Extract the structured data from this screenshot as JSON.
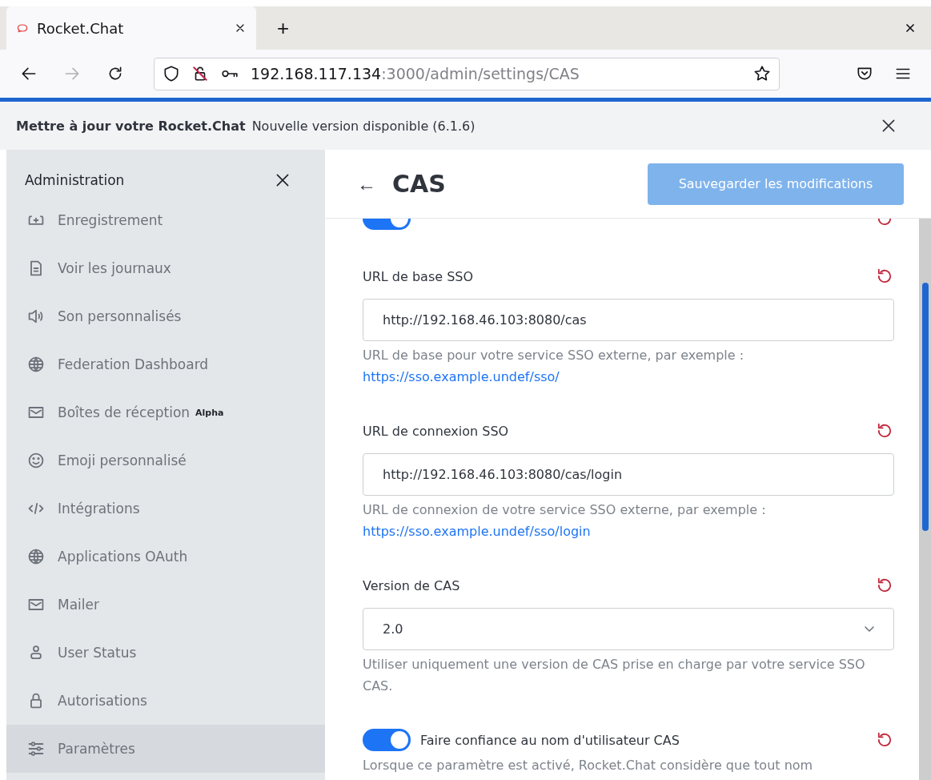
{
  "browser": {
    "tab": {
      "title": "Rocket.Chat"
    },
    "new_tab": "+",
    "url": {
      "host": "192.168.117.134",
      "path": ":3000/admin/settings/CAS"
    }
  },
  "banner": {
    "title": "Mettre à jour votre Rocket.Chat",
    "message": "Nouvelle version disponible (6.1.6)"
  },
  "sidebar": {
    "title": "Administration",
    "items": [
      {
        "label": "Enregistrement",
        "selected": false
      },
      {
        "label": "Voir les journaux",
        "selected": false
      },
      {
        "label": "Son personnalisés",
        "selected": false
      },
      {
        "label": "Federation Dashboard",
        "selected": false
      },
      {
        "label": "Boîtes de réception",
        "badge": "Alpha",
        "selected": false
      },
      {
        "label": "Emoji personnalisé",
        "selected": false
      },
      {
        "label": "Intégrations",
        "selected": false
      },
      {
        "label": "Applications OAuth",
        "selected": false
      },
      {
        "label": "Mailer",
        "selected": false
      },
      {
        "label": "User Status",
        "selected": false
      },
      {
        "label": "Autorisations",
        "selected": false
      },
      {
        "label": "Paramètres",
        "selected": true
      }
    ]
  },
  "page": {
    "back": "←",
    "title": "CAS",
    "save_button": {
      "label": "Sauvegarder les modifications",
      "disabled": true
    }
  },
  "settings": [
    {
      "kind": "toggle",
      "on": true
    },
    {
      "kind": "text",
      "label": "URL de base SSO",
      "value": "http://192.168.46.103:8080/cas",
      "hint": "URL de base pour votre service SSO externe, par exemple :",
      "link": "https://sso.example.undef/sso/"
    },
    {
      "kind": "text",
      "label": "URL de connexion SSO",
      "value": "http://192.168.46.103:8080/cas/login",
      "hint": "URL de connexion de votre service SSO externe, par exemple :",
      "link": "https://sso.example.undef/sso/login"
    },
    {
      "kind": "select",
      "label": "Version de CAS",
      "value": "2.0",
      "hint": "Utiliser uniquement une version de CAS prise en charge par votre service SSO CAS."
    },
    {
      "kind": "toggle",
      "on": true,
      "label": "Faire confiance au nom d'utilisateur CAS",
      "hint": "Lorsque ce paramètre est activé, Rocket.Chat considère que tout nom"
    }
  ]
}
